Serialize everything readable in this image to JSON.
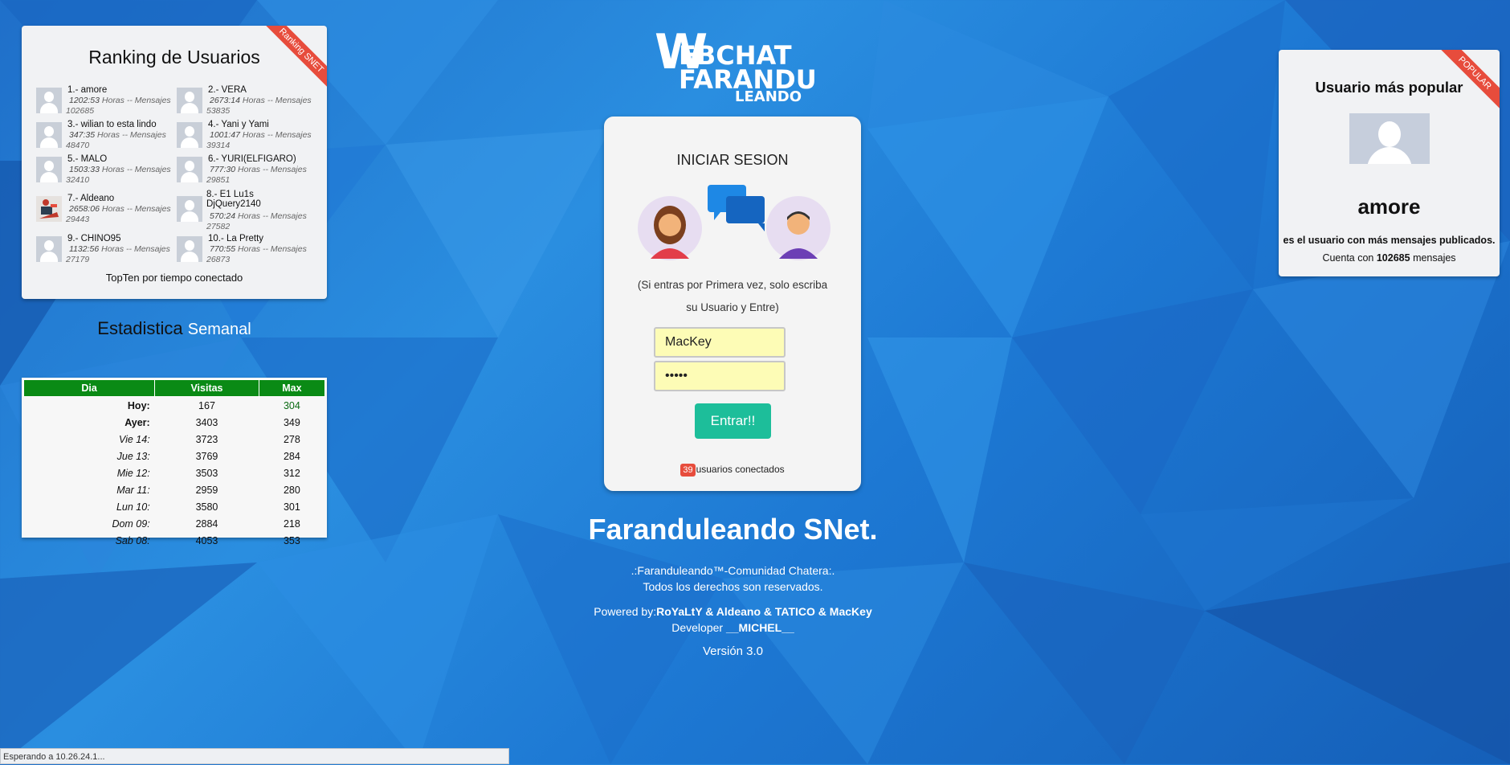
{
  "ranking": {
    "title": "Ranking de Usuarios",
    "ribbon": "Ranking SNET",
    "footer": "TopTen por tiempo conectado",
    "users": [
      {
        "name": "1.- amore",
        "hours": "1202:53",
        "suffix": "Horas -- Mensajes",
        "msgs": "102685",
        "avatar": "default"
      },
      {
        "name": "2.- VERA",
        "hours": "2673:14",
        "suffix": "Horas -- Mensajes",
        "msgs": "53835",
        "avatar": "default"
      },
      {
        "name": "3.- wilian to esta lindo",
        "hours": "347:35",
        "suffix": "Horas -- Mensajes",
        "msgs": "48470",
        "avatar": "default"
      },
      {
        "name": "4.- Yani y Yami",
        "hours": "1001:47",
        "suffix": "Horas -- Mensajes",
        "msgs": "39314",
        "avatar": "default"
      },
      {
        "name": "5.- MALO",
        "hours": "1503:33",
        "suffix": "Horas -- Mensajes",
        "msgs": "32410",
        "avatar": "default"
      },
      {
        "name": "6.- YURI(ELFIGARO)",
        "hours": "777:30",
        "suffix": "Horas -- Mensajes",
        "msgs": "29851",
        "avatar": "default"
      },
      {
        "name": "7.- Aldeano",
        "hours": "2658:06",
        "suffix": "Horas -- Mensajes",
        "msgs": "29443",
        "avatar": "custom"
      },
      {
        "name": "8.- E1 Lu1s DjQuery2140",
        "hours": "570:24",
        "suffix": "Horas -- Mensajes",
        "msgs": "27582",
        "avatar": "default"
      },
      {
        "name": "9.- CHINO95",
        "hours": "1132:56",
        "suffix": "Horas -- Mensajes",
        "msgs": "27179",
        "avatar": "default"
      },
      {
        "name": "10.- La Pretty",
        "hours": "770:55",
        "suffix": "Horas -- Mensajes",
        "msgs": "26873",
        "avatar": "default"
      }
    ]
  },
  "stats": {
    "title_main": "Estadistica",
    "title_sub": "Semanal",
    "headers": [
      "Dia",
      "Visitas",
      "Max"
    ],
    "rows": [
      [
        "Hoy:",
        "167",
        "304"
      ],
      [
        "Ayer:",
        "3403",
        "349"
      ],
      [
        "Vie 14:",
        "3723",
        "278"
      ],
      [
        "Jue 13:",
        "3769",
        "284"
      ],
      [
        "Mie 12:",
        "3503",
        "312"
      ],
      [
        "Mar 11:",
        "2959",
        "280"
      ],
      [
        "Lun 10:",
        "3580",
        "301"
      ],
      [
        "Dom 09:",
        "2884",
        "218"
      ],
      [
        "Sab 08:",
        "4053",
        "353"
      ]
    ]
  },
  "logo": {
    "w": "W",
    "line1": "EBCHAT",
    "line2": "FARANDU",
    "line3": "LEANDO"
  },
  "login": {
    "title": "INICIAR SESION",
    "hint": "(Si entras por Primera vez, solo escriba su Usuario y Entre)",
    "username_value": "MacKey",
    "password_value": "•••••",
    "button": "Entrar!!",
    "online_count": "39",
    "online_label": "usuarios conectados"
  },
  "footer": {
    "site_title": "Faranduleando SNet.",
    "community": ".:Faranduleando™-Comunidad Chatera:.",
    "rights": "Todos los derechos son reservados.",
    "powered_label": "Powered by:",
    "powered_names": "RoYaLtY & Aldeano & TATICO & MacKey",
    "developer_label": "Developer",
    "developer_name": "__MICHEL__",
    "version": "Versión 3.0"
  },
  "popular": {
    "ribbon": "POPULAR",
    "title": "Usuario más popular",
    "name": "amore",
    "line1": "es el usuario con más mensajes publicados.",
    "line2_pre": "Cuenta con",
    "line2_count": "102685",
    "line2_post": "mensajes"
  },
  "status_bar": "Esperando a 10.26.24.1...",
  "colors": {
    "accent": "#1dbe9a",
    "ribbon": "#e74c3c",
    "table_header": "#0a8a15",
    "input_bg": "#fdfcb6"
  }
}
